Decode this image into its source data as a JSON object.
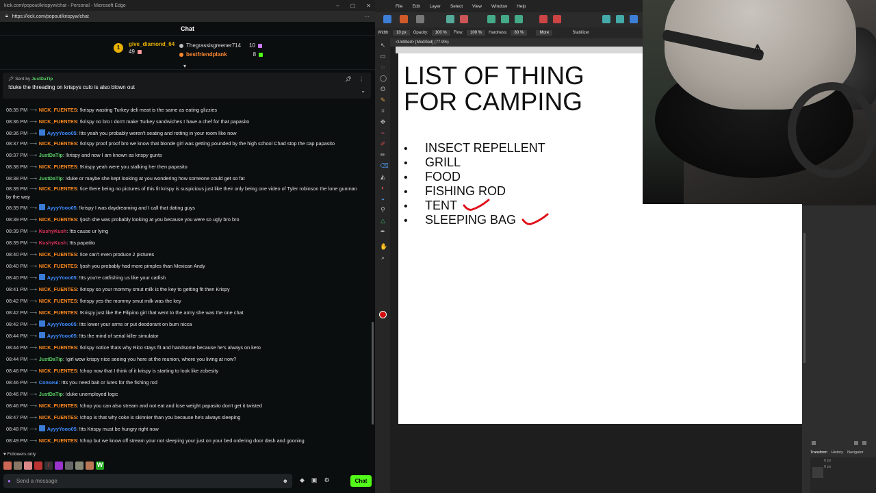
{
  "browser": {
    "title": "kick.com/popout/krispyw/chat - Personal - Microsoft Edge",
    "url": "https://kick.com/popout/krispyw/chat",
    "chat_title": "Chat"
  },
  "leaderboard": [
    {
      "name": "give_diamond_64",
      "amount": "49",
      "color": "#e8b100"
    },
    {
      "name": "Thegrassisgreener714",
      "amount": "10",
      "color": "#dddddd"
    },
    {
      "name": "bestfriendplank",
      "amount": "8",
      "color": "#ff8a30"
    }
  ],
  "pinned": {
    "sent_by_label": "Sent by",
    "user": "JustDaTip",
    "message": "!duke the threading on krispys culo is also blown out"
  },
  "messages": [
    {
      "time": "08:35 PM",
      "user": "NICK_FUENTES",
      "color": "#ff8a1e",
      "badge": false,
      "text": ": !krispy wasting Turkey deli meat is the same as eating glizzies"
    },
    {
      "time": "08:36 PM",
      "user": "NICK_FUENTES",
      "color": "#ff8a1e",
      "badge": false,
      "text": ": !krispy no bro I don't make Turkey sandwiches I have a chef for that papasito"
    },
    {
      "time": "08:36 PM",
      "user": "AyyyYooo05",
      "color": "#3f8cff",
      "badge": true,
      "text": ": !tts yeah you probably weren't seating and rotting in your room like now"
    },
    {
      "time": "08:37 PM",
      "user": "NICK_FUENTES",
      "color": "#ff8a1e",
      "badge": false,
      "text": ": !krispy proof proof bro we know that blonde girl was getting pounded by the high school Chad stop the cap papasito"
    },
    {
      "time": "08:37 PM",
      "user": "JustDaTip",
      "color": "#5ad066",
      "badge": false,
      "text": ": !krispy and now I am known as krispy gunts"
    },
    {
      "time": "08:38 PM",
      "user": "NICK_FUENTES",
      "color": "#ff8a1e",
      "badge": false,
      "text": ": !Krispy yeah were you stalking her then papasito"
    },
    {
      "time": "08:38 PM",
      "user": "JustDaTip",
      "color": "#5ad066",
      "badge": false,
      "text": ": !duke or maybe she kept looking at you wondering how someone could get so fat"
    },
    {
      "time": "08:39 PM",
      "user": "NICK_FUENTES",
      "color": "#ff8a1e",
      "badge": false,
      "text": ": !ice there being no pictures of this fit krispy is suspicious just like their only being one video of Tyler robinson the lone gunman by the way"
    },
    {
      "time": "08:39 PM",
      "user": "AyyyYooo05",
      "color": "#3f8cff",
      "badge": true,
      "text": ": !krispy I was daydreaming and I call that dating guys"
    },
    {
      "time": "08:39 PM",
      "user": "NICK_FUENTES",
      "color": "#ff8a1e",
      "badge": false,
      "text": ": !josh she was probably looking at you because you were so ugly bro bro"
    },
    {
      "time": "08:39 PM",
      "user": "KushyKush",
      "color": "#e0315a",
      "badge": false,
      "text": ": !tts cause ur lying"
    },
    {
      "time": "08:39 PM",
      "user": "KushyKush",
      "color": "#e0315a",
      "badge": false,
      "text": ": !tts papatito"
    },
    {
      "time": "08:40 PM",
      "user": "NICK_FUENTES",
      "color": "#ff8a1e",
      "badge": false,
      "text": ": !ice can't even produce 2 pictures"
    },
    {
      "time": "08:40 PM",
      "user": "NICK_FUENTES",
      "color": "#ff8a1e",
      "badge": false,
      "text": ": !josh you probably had more pimples than Mexican Andy"
    },
    {
      "time": "08:40 PM",
      "user": "AyyyYooo05",
      "color": "#3f8cff",
      "badge": true,
      "text": ": !tts you're catfishing us like your catfish"
    },
    {
      "time": "08:41 PM",
      "user": "NICK_FUENTES",
      "color": "#ff8a1e",
      "badge": false,
      "text": ": !krispy so your mommy smut milk is the key to getting fit then Krispy"
    },
    {
      "time": "08:42 PM",
      "user": "NICK_FUENTES",
      "color": "#ff8a1e",
      "badge": false,
      "text": ": !krispy yes the mommy smut milk was the key"
    },
    {
      "time": "08:42 PM",
      "user": "NICK_FUENTES",
      "color": "#ff8a1e",
      "badge": false,
      "text": ": !Krispy just like the Filipino girl that went to the army she was the one chat"
    },
    {
      "time": "08:42 PM",
      "user": "AyyyYooo05",
      "color": "#3f8cff",
      "badge": true,
      "text": ": !tts lower your arms or put deodorant on bum nicca"
    },
    {
      "time": "08:44 PM",
      "user": "AyyyYooo05",
      "color": "#3f8cff",
      "badge": true,
      "text": ": !tts the mind of serial killer simulator"
    },
    {
      "time": "08:44 PM",
      "user": "NICK_FUENTES",
      "color": "#ff8a1e",
      "badge": false,
      "text": ": !krispy notice thats why Rico stays fit and handsome because he's always on keto"
    },
    {
      "time": "08:44 PM",
      "user": "JustDaTip",
      "color": "#5ad066",
      "badge": false,
      "text": ": !girl wow krispy nice seeing you here at the reunion, where you living at now?"
    },
    {
      "time": "08:46 PM",
      "user": "NICK_FUENTES",
      "color": "#ff8a1e",
      "badge": false,
      "text": ": !chop now that I think of it krispy is starting to look like zobesity"
    },
    {
      "time": "08:46 PM",
      "user": "Conseui",
      "color": "#3f8cff",
      "badge": false,
      "text": ": !tts you need bait or lures for the fishing rod"
    },
    {
      "time": "08:46 PM",
      "user": "JustDaTip",
      "color": "#5ad066",
      "badge": false,
      "text": ": !duke unemployed logic"
    },
    {
      "time": "08:46 PM",
      "user": "NICK_FUENTES",
      "color": "#ff8a1e",
      "badge": false,
      "text": ": !chop you can also stream and not eat and lose weight papasito don't get it twisted"
    },
    {
      "time": "08:47 PM",
      "user": "NICK_FUENTES",
      "color": "#ff8a1e",
      "badge": false,
      "text": ": !chop is that why coke is skinnier than you because he's always sleeping"
    },
    {
      "time": "08:48 PM",
      "user": "AyyyYooo05",
      "color": "#3f8cff",
      "badge": true,
      "text": ": !tts Krispy must be hungry right now"
    },
    {
      "time": "08:49 PM",
      "user": "NICK_FUENTES",
      "color": "#ff8a1e",
      "badge": false,
      "text": ": !chop but we know off stream your not sleeping your just on your bed ordering door dash and gooning"
    }
  ],
  "chat_footer": {
    "followers_only": "Followers only",
    "input_placeholder": "Send a message",
    "chat_button": "Chat"
  },
  "paint": {
    "menu": [
      "File",
      "Edit",
      "Layer",
      "Select",
      "View",
      "Window",
      "Help"
    ],
    "options": {
      "width_label": "Width:",
      "width_value": "10 px",
      "opacity_label": "Opacity:",
      "opacity_value": "100 %",
      "flow_label": "Flow:",
      "flow_value": "100 %",
      "hardness_label": "Hardness:",
      "hardness_value": "80 %",
      "more_label": "More",
      "stabilizer_label": "Stabilizer"
    },
    "doc_tab": "<Untitled> [Modified] (77.9%)",
    "heading_line1": "LIST OF THING",
    "heading_line2": "FOR CAMPING",
    "bullet": "•",
    "items": [
      "INSECT REPELLENT",
      "GRILL",
      "FOOD",
      "FISHING ROD",
      "TENT",
      "SLEEPING BAG"
    ],
    "checked_items": [
      "TENT",
      "SLEEPING BAG"
    ],
    "check_color": "#e0101a",
    "panel_tabs": [
      "Transform",
      "History",
      "Navigator"
    ],
    "transform_values": [
      "0 px",
      "0 px"
    ]
  }
}
